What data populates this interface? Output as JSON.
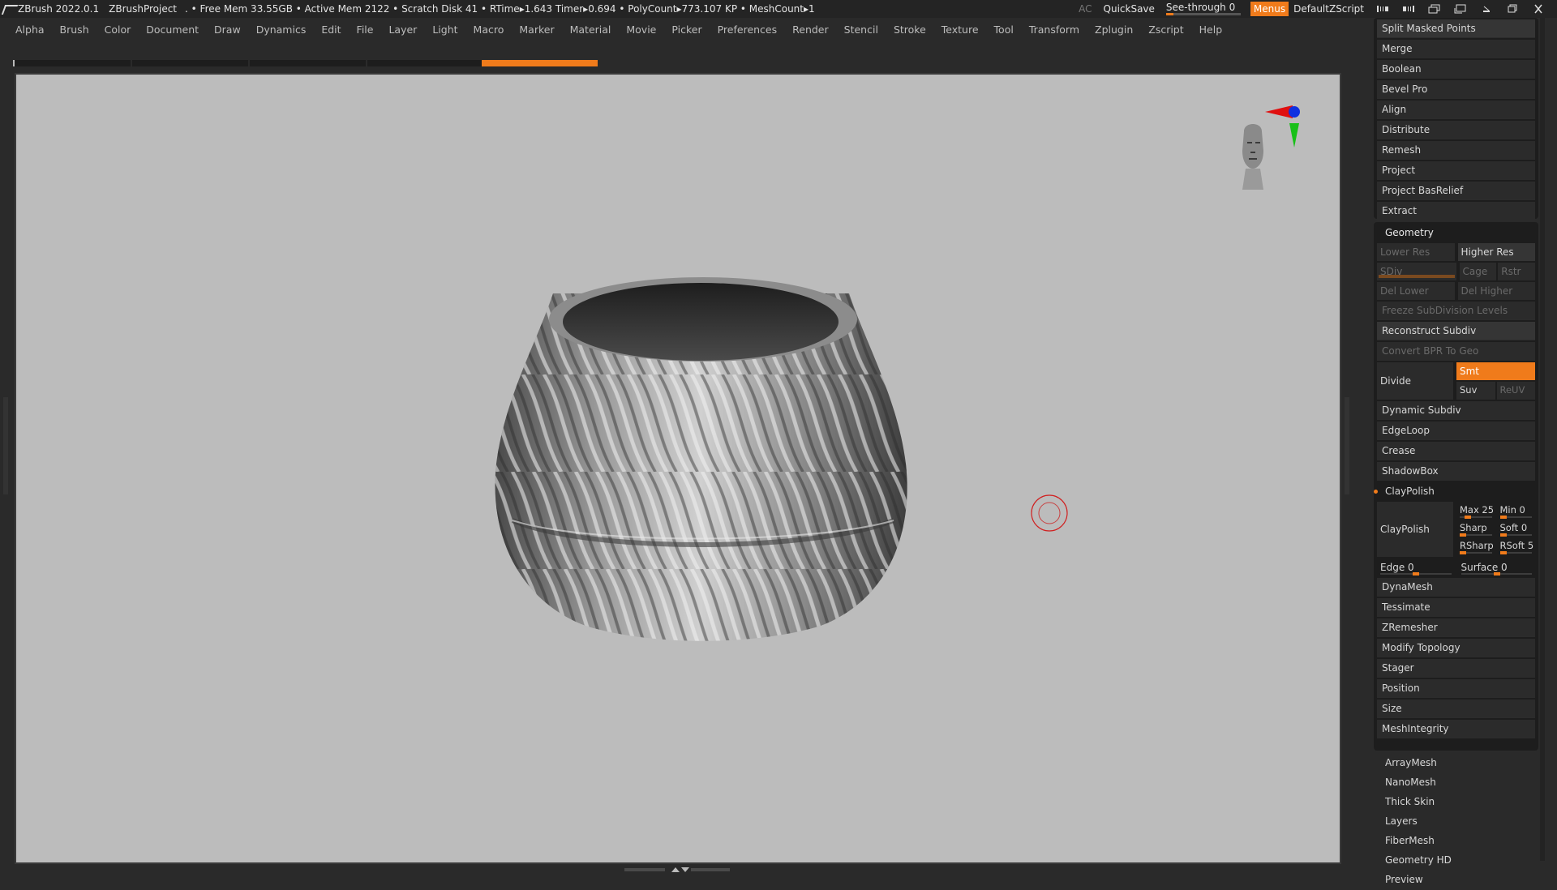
{
  "titlebar": {
    "app": "ZBrush 2022.0.1",
    "project": "ZBrushProject",
    "stats": ". • Free Mem 33.55GB • Active Mem 2122 • Scratch Disk 41 •  RTime▸1.643 Timer▸0.694 • PolyCount▸773.107 KP  • MeshCount▸1",
    "ac": "AC",
    "quicksave": "QuickSave",
    "seethrough_label": "See-through   0",
    "seethrough_value": 0.05,
    "menus": "Menus",
    "script": "DefaultZScript"
  },
  "menubar": [
    "Alpha",
    "Brush",
    "Color",
    "Document",
    "Draw",
    "Dynamics",
    "Edit",
    "File",
    "Layer",
    "Light",
    "Macro",
    "Marker",
    "Material",
    "Movie",
    "Picker",
    "Preferences",
    "Render",
    "Stencil",
    "Stroke",
    "Texture",
    "Tool",
    "Transform",
    "Zplugin",
    "Zscript",
    "Help"
  ],
  "panel": {
    "subtool_items": [
      "Split Masked Points",
      "Merge",
      "Boolean",
      "Bevel Pro",
      "Align",
      "Distribute",
      "Remesh",
      "Project",
      "Project BasRelief",
      "Extract"
    ],
    "geometry": {
      "title": "Geometry",
      "lower_res": "Lower Res",
      "higher_res": "Higher Res",
      "sdiv": "SDiv",
      "cage": "Cage",
      "rstr": "Rstr",
      "del_lower": "Del Lower",
      "del_higher": "Del Higher",
      "freeze": "Freeze SubDivision Levels",
      "reconstruct": "Reconstruct Subdiv",
      "convert_bpr": "Convert BPR To Geo",
      "divide": "Divide",
      "smt": "Smt",
      "suv": "Suv",
      "reuv": "ReUV",
      "items_a": [
        "Dynamic Subdiv",
        "EdgeLoop",
        "Crease",
        "ShadowBox"
      ],
      "claypolish_head": "ClayPolish",
      "claypolish_btn": "ClayPolish",
      "max": "Max 25",
      "min": "Min 0",
      "sharp": "Sharp",
      "soft": "Soft 0",
      "rsharp": "RSharp",
      "rsoft": "RSoft 5",
      "edge": "Edge 0",
      "surface": "Surface 0",
      "items_b": [
        "DynaMesh",
        "Tessimate",
        "ZRemesher",
        "Modify Topology",
        "Stager",
        "Position",
        "Size",
        "MeshIntegrity"
      ]
    },
    "bottom_items": [
      "ArrayMesh",
      "NanoMesh",
      "Thick Skin",
      "Layers",
      "FiberMesh",
      "Geometry HD",
      "Preview"
    ]
  },
  "colors": {
    "accent": "#f07b1b",
    "viewport_bg": "#bcbcbc",
    "panel_bg": "#1d1d1d"
  }
}
